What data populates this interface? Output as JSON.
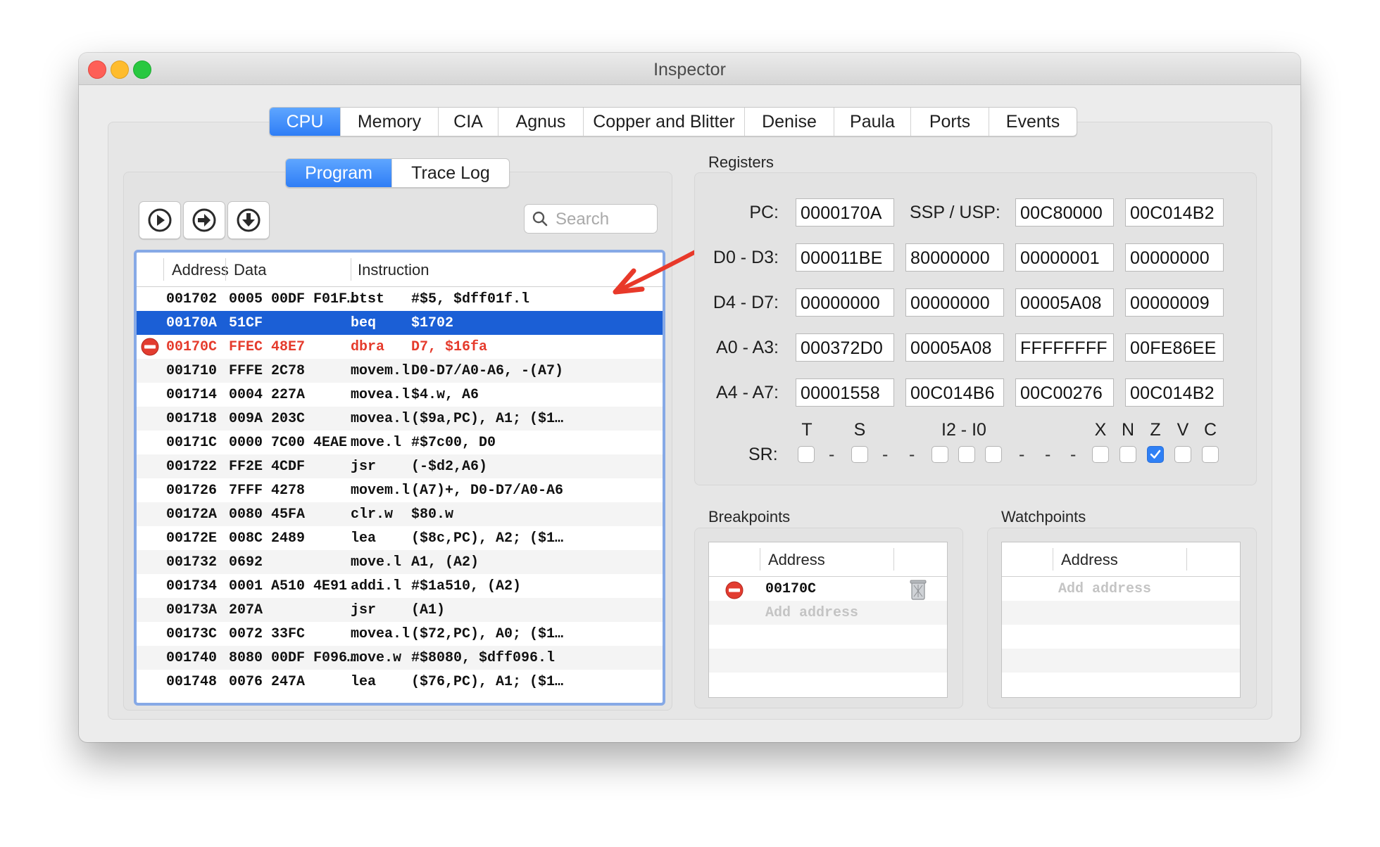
{
  "window": {
    "title": "Inspector",
    "traffic_lights": [
      "#fe5f57",
      "#febc2e",
      "#28c840"
    ]
  },
  "main_tabs": [
    {
      "label": "CPU",
      "active": true
    },
    {
      "label": "Memory"
    },
    {
      "label": "CIA"
    },
    {
      "label": "Agnus"
    },
    {
      "label": "Copper and Blitter"
    },
    {
      "label": "Denise"
    },
    {
      "label": "Paula"
    },
    {
      "label": "Ports"
    },
    {
      "label": "Events"
    }
  ],
  "sub_tabs": [
    {
      "label": "Program",
      "active": true
    },
    {
      "label": "Trace Log"
    }
  ],
  "toolbar": {
    "buttons": [
      "play-icon",
      "step-over-icon",
      "step-into-icon"
    ],
    "search_placeholder": "Search"
  },
  "instructions": {
    "columns": [
      "Address",
      "Data",
      "Instruction"
    ],
    "rows": [
      {
        "address": "001702",
        "data": "0005 00DF F01F…",
        "mnemonic": "btst",
        "operands": "#$5, $dff01f.l"
      },
      {
        "address": "00170A",
        "data": "51CF",
        "mnemonic": "beq",
        "operands": "$1702",
        "selected": true
      },
      {
        "address": "00170C",
        "data": "FFEC 48E7",
        "mnemonic": "dbra",
        "operands": "D7, $16fa",
        "breakpoint": true
      },
      {
        "address": "001710",
        "data": "FFFE 2C78",
        "mnemonic": "movem.l",
        "operands": "D0-D7/A0-A6, -(A7)"
      },
      {
        "address": "001714",
        "data": "0004 227A",
        "mnemonic": "movea.l",
        "operands": "$4.w, A6"
      },
      {
        "address": "001718",
        "data": "009A 203C",
        "mnemonic": "movea.l",
        "operands": "($9a,PC), A1; ($1…"
      },
      {
        "address": "00171C",
        "data": "0000 7C00 4EAE",
        "mnemonic": "move.l",
        "operands": "#$7c00, D0"
      },
      {
        "address": "001722",
        "data": "FF2E 4CDF",
        "mnemonic": "jsr",
        "operands": "(-$d2,A6)"
      },
      {
        "address": "001726",
        "data": "7FFF 4278",
        "mnemonic": "movem.l",
        "operands": "(A7)+, D0-D7/A0-A6"
      },
      {
        "address": "00172A",
        "data": "0080 45FA",
        "mnemonic": "clr.w",
        "operands": "$80.w"
      },
      {
        "address": "00172E",
        "data": "008C 2489",
        "mnemonic": "lea",
        "operands": "($8c,PC), A2; ($1…"
      },
      {
        "address": "001732",
        "data": "0692",
        "mnemonic": "move.l",
        "operands": "A1, (A2)"
      },
      {
        "address": "001734",
        "data": "0001 A510 4E91",
        "mnemonic": "addi.l",
        "operands": "#$1a510, (A2)"
      },
      {
        "address": "00173A",
        "data": "207A",
        "mnemonic": "jsr",
        "operands": "(A1)"
      },
      {
        "address": "00173C",
        "data": "0072 33FC",
        "mnemonic": "movea.l",
        "operands": "($72,PC), A0; ($1…"
      },
      {
        "address": "001740",
        "data": "8080 00DF F096…",
        "mnemonic": "move.w",
        "operands": "#$8080, $dff096.l"
      },
      {
        "address": "001748",
        "data": "0076 247A",
        "mnemonic": "lea",
        "operands": "($76,PC), A1; ($1…"
      }
    ]
  },
  "registers": {
    "title": "Registers",
    "rows": [
      {
        "label": "PC:",
        "values": [
          "0000170A"
        ],
        "extra_label": "SSP / USP:",
        "extra_values": [
          "00C80000",
          "00C014B2"
        ]
      },
      {
        "label": "D0 - D3:",
        "values": [
          "000011BE",
          "80000000",
          "00000001",
          "00000000"
        ]
      },
      {
        "label": "D4 - D7:",
        "values": [
          "00000000",
          "00000000",
          "00005A08",
          "00000009"
        ]
      },
      {
        "label": "A0 - A3:",
        "values": [
          "000372D0",
          "00005A08",
          "FFFFFFFF",
          "00FE86EE"
        ]
      },
      {
        "label": "A4 - A7:",
        "values": [
          "00001558",
          "00C014B6",
          "00C00276",
          "00C014B2"
        ]
      }
    ],
    "sr": {
      "label": "SR:",
      "flag_labels": [
        "T",
        "S",
        "I2 - I0",
        "X",
        "N",
        "Z",
        "V",
        "C"
      ],
      "separator": "-",
      "bits": [
        false,
        false,
        false,
        false,
        false,
        false,
        false,
        true,
        false,
        false
      ]
    }
  },
  "breakpoints": {
    "title": "Breakpoints",
    "column": "Address",
    "items": [
      "00170C"
    ],
    "add_placeholder": "Add address"
  },
  "watchpoints": {
    "title": "Watchpoints",
    "column": "Address",
    "items": [],
    "add_placeholder": "Add address"
  },
  "colors": {
    "accent": "#2f7ef6",
    "selection": "#1b5fd6",
    "breakpoint_text": "#e53b2c",
    "annotation_arrow": "#e8392a"
  }
}
